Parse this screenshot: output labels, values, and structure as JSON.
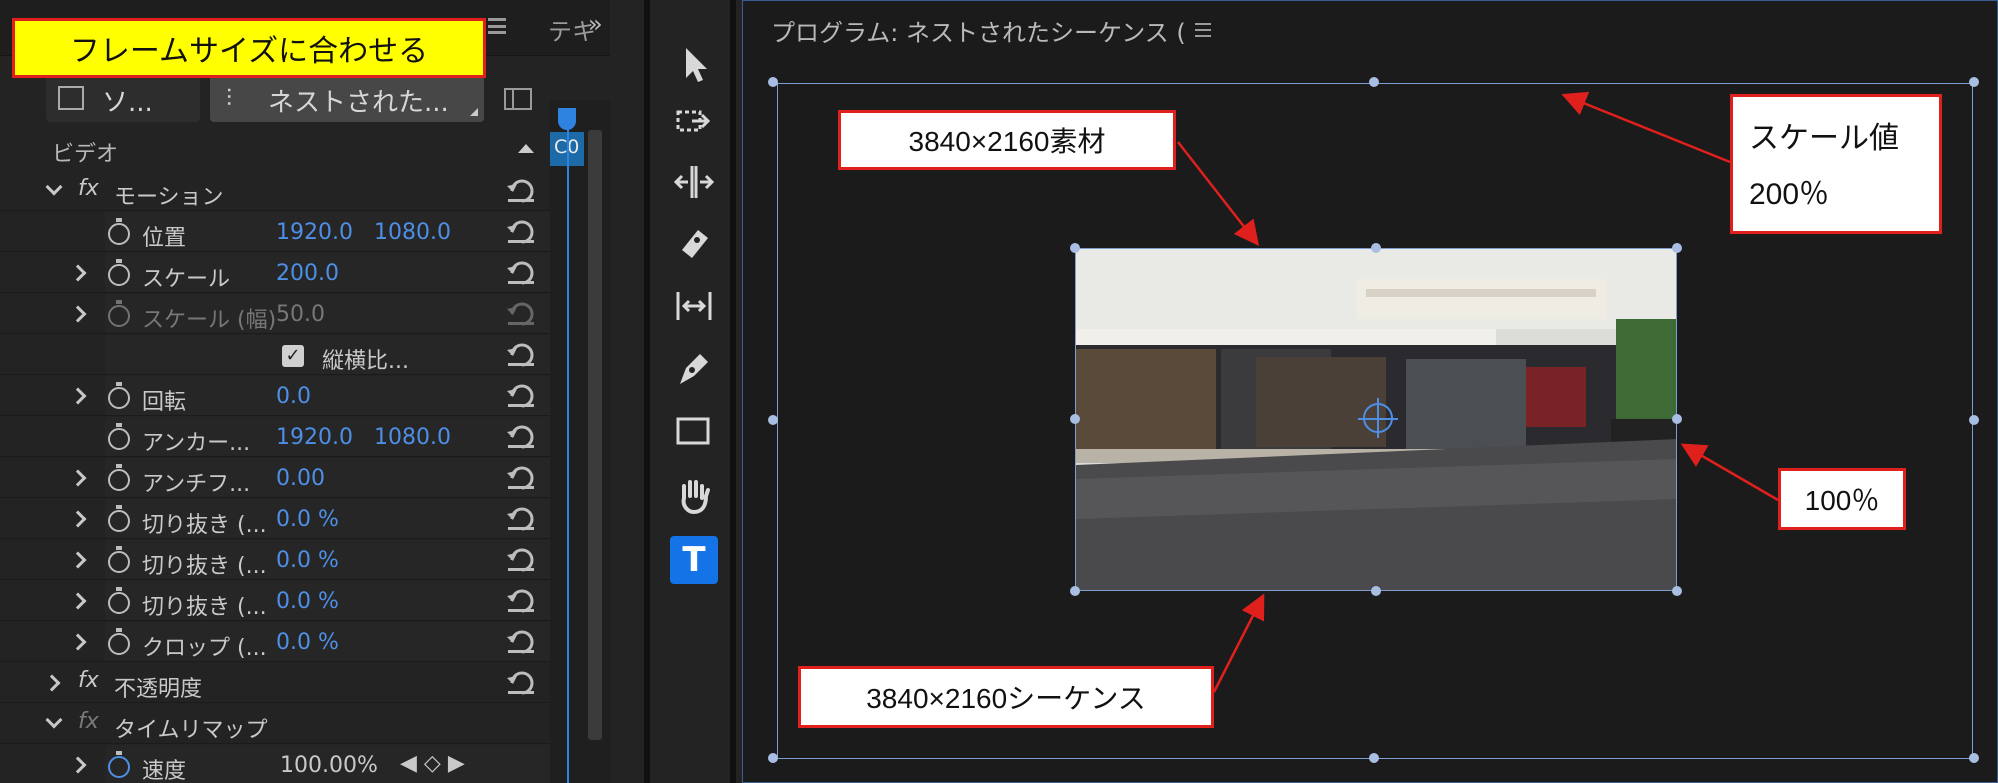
{
  "banner": "フレームサイズに合わせる",
  "left_panel": {
    "tab_text": "テキ",
    "source_buttons": [
      "ソ...",
      "ネストされた..."
    ],
    "section_video": "ビデオ",
    "rows": [
      {
        "label": "モーション"
      },
      {
        "label": "位置",
        "v1": "1920.0",
        "v2": "1080.0"
      },
      {
        "label": "スケール",
        "v1": "200.0"
      },
      {
        "label": "スケール (幅)",
        "v1": "50.0"
      },
      {
        "label": "縦横比..."
      },
      {
        "label": "回転",
        "v1": "0.0"
      },
      {
        "label": "アンカー...",
        "v1": "1920.0",
        "v2": "1080.0"
      },
      {
        "label": "アンチフ...",
        "v1": "0.00"
      },
      {
        "label": "切り抜き (...",
        "v1": "0.0 %"
      },
      {
        "label": "切り抜き (...",
        "v1": "0.0 %"
      },
      {
        "label": "切り抜き (...",
        "v1": "0.0 %"
      },
      {
        "label": "クロップ (...",
        "v1": "0.0 %"
      },
      {
        "label": "不透明度"
      },
      {
        "label": "タイムリマップ"
      },
      {
        "label": "速度",
        "v1": "100.00%"
      }
    ],
    "clip_label": "C0"
  },
  "program": {
    "title": "プログラム: ネストされたシーケンス ("
  },
  "callouts": {
    "material": "3840×2160素材",
    "scale_line1": "スケール値",
    "scale_line2": "200％",
    "percent": "100％",
    "sequence": "3840×2160シーケンス"
  }
}
